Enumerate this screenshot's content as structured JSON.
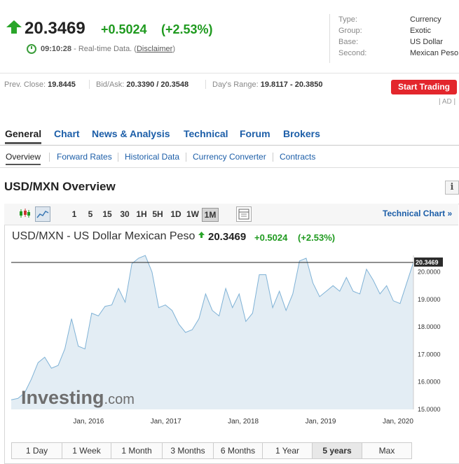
{
  "quote": {
    "price": "20.3469",
    "change": "+0.5024",
    "change_pct": "(+2.53%)",
    "time": "09:10:28",
    "time_note": " - Real-time Data. (",
    "disclaimer": "Disclaimer",
    "close_paren": ")"
  },
  "info": {
    "rows": [
      {
        "key": "Type:",
        "value": "Currency"
      },
      {
        "key": "Group:",
        "value": "Exotic"
      },
      {
        "key": "Base:",
        "value": "US Dollar"
      },
      {
        "key": "Second:",
        "value": "Mexican Peso"
      }
    ]
  },
  "stats": {
    "prev_close_label": "Prev. Close:",
    "prev_close": "19.8445",
    "bid_ask_label": "Bid/Ask:",
    "bid_ask": "20.3390 / 20.3548",
    "range_label": "Day's Range:",
    "range": "19.8117 - 20.3850"
  },
  "cta": {
    "start_trading": "Start Trading",
    "ad": "| AD |"
  },
  "main_tabs": [
    "General",
    "Chart",
    "News & Analysis",
    "Technical",
    "Forum",
    "Brokers"
  ],
  "sub_tabs": [
    "Overview",
    "Forward Rates",
    "Historical Data",
    "Currency Converter",
    "Contracts"
  ],
  "overview_title": "USD/MXN Overview",
  "info_icon": "i",
  "toolbar": {
    "intervals": [
      "1",
      "5",
      "15",
      "30",
      "1H",
      "5H",
      "1D",
      "1W",
      "1M"
    ],
    "active_interval": "1M",
    "technical_chart": "Technical Chart »",
    "icons": [
      "candlestick-icon",
      "area-chart-icon",
      "table-icon"
    ]
  },
  "chart_header": {
    "title": "USD/MXN - US Dollar Mexican Peso",
    "price": "20.3469",
    "change": "+0.5024",
    "change_pct": "(+2.53%)"
  },
  "range_buttons": [
    "1 Day",
    "1 Week",
    "1 Month",
    "3 Months",
    "6 Months",
    "1 Year",
    "5 years",
    "Max"
  ],
  "active_range": "5 years",
  "watermark": {
    "brand": "Investing",
    "suffix": ".com"
  },
  "colors": {
    "up": "#1f9a1f",
    "link": "#1c5ea8",
    "cta": "#e3262c",
    "area_fill": "#e3edf4",
    "area_line": "#7fb2d6"
  },
  "chart_data": {
    "type": "area",
    "title": "USD/MXN - US Dollar Mexican Peso",
    "x_ticks": [
      "Jan, 2016",
      "Jan, 2017",
      "Jan, 2018",
      "Jan, 2019",
      "Jan, 2020"
    ],
    "y_ticks": [
      "15.0000",
      "16.0000",
      "17.0000",
      "18.0000",
      "19.0000",
      "20.0000"
    ],
    "ylim": [
      15.0,
      20.6
    ],
    "current_label": "20.3469",
    "current_value": 20.3469,
    "x_start": 2015.0,
    "x_end": 2020.2,
    "values": [
      15.35,
      15.4,
      15.6,
      16.1,
      16.7,
      16.9,
      16.5,
      16.6,
      17.2,
      18.3,
      17.3,
      17.2,
      18.5,
      18.4,
      18.75,
      18.8,
      19.4,
      18.9,
      20.3,
      20.5,
      20.6,
      20.0,
      18.7,
      18.8,
      18.6,
      18.1,
      17.8,
      17.9,
      18.3,
      19.2,
      18.6,
      18.4,
      19.4,
      18.7,
      19.2,
      18.2,
      18.5,
      19.9,
      19.9,
      18.7,
      19.3,
      18.6,
      19.2,
      20.4,
      20.5,
      19.6,
      19.1,
      19.3,
      19.5,
      19.3,
      19.8,
      19.3,
      19.2,
      20.1,
      19.7,
      19.2,
      19.5,
      18.95,
      18.85,
      19.6,
      20.35
    ],
    "grid": false,
    "legend": "none"
  }
}
